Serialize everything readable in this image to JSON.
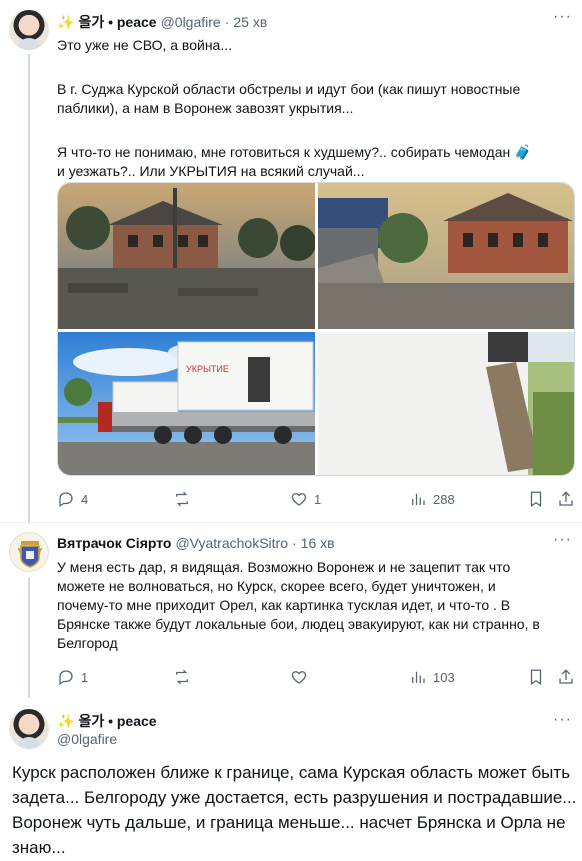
{
  "posts": [
    {
      "author": "ᄋᄋ 올가 • peace",
      "sparkle": "✨",
      "name": "올가 • peace",
      "handle": "@0lgafire",
      "time": "25 хв",
      "lines": [
        "Это уже не СВО, а война...",
        "",
        "В г. Суджа Курской области обстрелы и идут бои (как пишут новостные",
        "паблики), а нам в Воронеж завозят укрытия...",
        "",
        "Я что-то не понимаю, мне готовиться к худшему?.. собирать чемодан 🧳",
        "и уезжать?.. Или УКРЫТИЯ на всякий случай..."
      ],
      "container_label": "УКРЫТИЕ",
      "stats": {
        "replies": "4",
        "reposts": "",
        "likes": "1",
        "views": "288"
      }
    },
    {
      "name": "Вятрачок Сіярто",
      "handle": "@VyatrachokSitro",
      "time": "16 хв",
      "lines": [
        "У меня есть дар, я видящая. Возможно Воронеж и не зацепит так что",
        "можете не волноваться, но Курск, скорее всего, будет уничтожен, и",
        "почему-то мне приходит Орел, как картинка тусклая идет, и что-то . В",
        "Брянске также будут локальные бои, людец эвакуируют, как ни странно, в",
        "Белгород"
      ],
      "stats": {
        "replies": "1",
        "reposts": "",
        "likes": "",
        "views": "103"
      }
    },
    {
      "sparkle": "✨",
      "name": "올가 • peace",
      "handle": "@0lgafire",
      "lines": [
        "Курск расположен ближе к границе, сама Курская область может быть",
        "задета... Белгороду уже достается, есть разрушения и пострадавшие...",
        "Воронеж чуть дальше, и граница меньше... насчет Брянска и Орла не",
        "знаю..."
      ]
    }
  ],
  "colors": {
    "text": "#0f1419",
    "muted": "#536471",
    "border": "#cfd9de",
    "sparkle": "#f5b400"
  }
}
